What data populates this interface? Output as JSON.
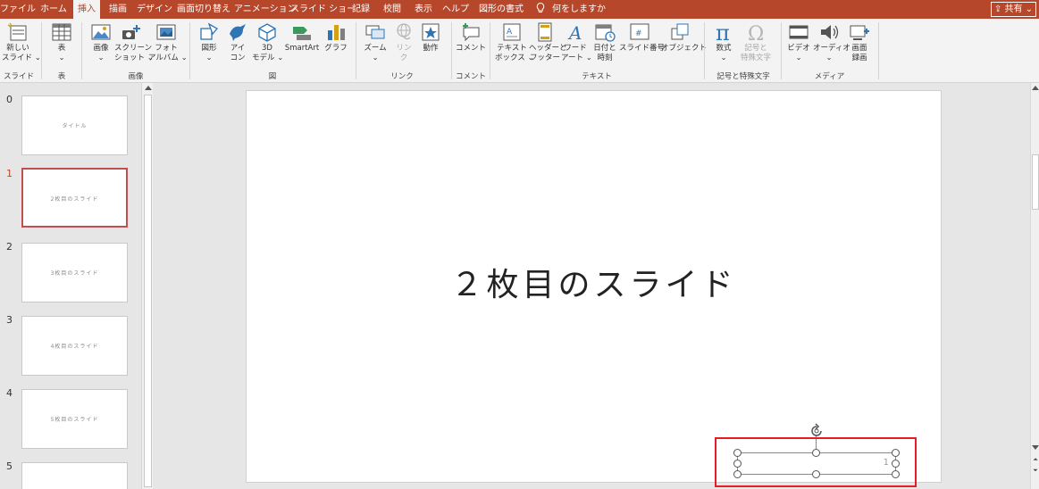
{
  "tabs": [
    "ファイル",
    "ホーム",
    "挿入",
    "描画",
    "デザイン",
    "画面切り替え",
    "アニメーション",
    "スライド ショー",
    "記録",
    "校閲",
    "表示",
    "ヘルプ",
    "図形の書式"
  ],
  "tell_me": "何をしますか",
  "share_label": "共有",
  "ribbon": {
    "buttons": [
      {
        "l1": "新しい",
        "l2": "スライド ⌄",
        "disabled": false
      },
      {
        "l1": "表",
        "l2": "⌄",
        "disabled": false
      },
      {
        "l1": "画像",
        "l2": "⌄",
        "disabled": false
      },
      {
        "l1": "スクリーン",
        "l2": "ショット ⌄",
        "disabled": false
      },
      {
        "l1": "フォト",
        "l2": "アルバム ⌄",
        "disabled": false
      },
      {
        "l1": "図形",
        "l2": "⌄",
        "disabled": false
      },
      {
        "l1": "アイ",
        "l2": "コン",
        "disabled": false
      },
      {
        "l1": "3D",
        "l2": "モデル ⌄",
        "disabled": false
      },
      {
        "l1": "SmartArt",
        "l2": "",
        "disabled": false
      },
      {
        "l1": "グラフ",
        "l2": "",
        "disabled": false
      },
      {
        "l1": "ズーム",
        "l2": "⌄",
        "disabled": false
      },
      {
        "l1": "リン",
        "l2": "ク",
        "disabled": true
      },
      {
        "l1": "動作",
        "l2": "",
        "disabled": false
      },
      {
        "l1": "コメント",
        "l2": "",
        "disabled": false
      },
      {
        "l1": "テキスト",
        "l2": "ボックス ⌄",
        "disabled": false
      },
      {
        "l1": "ヘッダーと",
        "l2": "フッター",
        "disabled": false
      },
      {
        "l1": "ワード",
        "l2": "アート ⌄",
        "disabled": false
      },
      {
        "l1": "日付と",
        "l2": "時刻",
        "disabled": false
      },
      {
        "l1": "スライド番号",
        "l2": "",
        "disabled": false
      },
      {
        "l1": "オブジェクト",
        "l2": "",
        "disabled": false
      },
      {
        "l1": "数式",
        "l2": "⌄",
        "disabled": false
      },
      {
        "l1": "記号と",
        "l2": "特殊文字",
        "disabled": true
      },
      {
        "l1": "ビデオ",
        "l2": "⌄",
        "disabled": false
      },
      {
        "l1": "オーディオ",
        "l2": "⌄",
        "disabled": false
      },
      {
        "l1": "画面",
        "l2": "録画",
        "disabled": false
      }
    ],
    "groups": [
      "スライド",
      "表",
      "画像",
      "図",
      "リンク",
      "コメント",
      "テキスト",
      "記号と特殊文字",
      "メディア"
    ]
  },
  "thumbnails": [
    {
      "num": "0",
      "text": "タイトル"
    },
    {
      "num": "1",
      "text": "2枚目のスライド"
    },
    {
      "num": "2",
      "text": "3枚目のスライド"
    },
    {
      "num": "3",
      "text": "4枚目のスライド"
    },
    {
      "num": "4",
      "text": "5枚目のスライド"
    },
    {
      "num": "5",
      "text": ""
    }
  ],
  "slide": {
    "title": "２枚目のスライド",
    "slide_number": "1"
  },
  "colors": {
    "accent": "#b7472a",
    "highlight": "#e51d2a"
  }
}
